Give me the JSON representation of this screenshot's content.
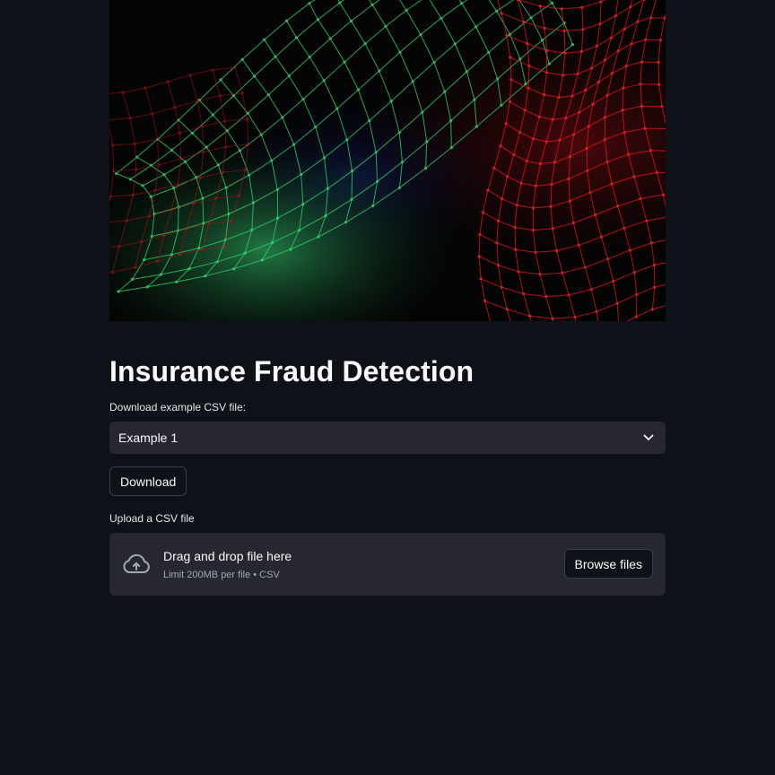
{
  "hero": {
    "image": "abstract-network-mesh-green-red"
  },
  "title": "Insurance Fraud Detection",
  "download_section": {
    "label": "Download example CSV file:",
    "select_value": "Example 1",
    "button_label": "Download"
  },
  "upload_section": {
    "label": "Upload a CSV file",
    "drop_title": "Drag and drop file here",
    "drop_limit": "Limit 200MB per file • CSV",
    "browse_label": "Browse files",
    "icon": "cloud-upload-icon"
  },
  "colors": {
    "background": "#0e1117",
    "widget": "#262730",
    "text": "#fafafa",
    "muted": "#a3a8b4",
    "mesh_green": "#2fd26a",
    "mesh_red": "#e8121b"
  }
}
